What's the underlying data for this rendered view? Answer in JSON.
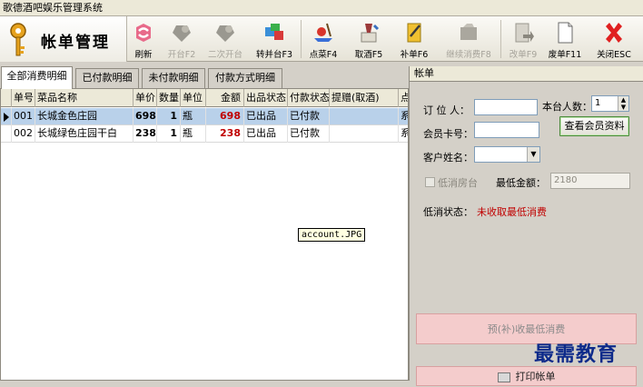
{
  "window": {
    "title": "歌德酒吧娱乐管理系统"
  },
  "header": {
    "logo_text": "帐单管理"
  },
  "toolbar": [
    {
      "key": "refresh",
      "label": "刷新",
      "icon": "refresh-icon",
      "enabled": true
    },
    {
      "key": "open_table",
      "label": "开台F2",
      "icon": "open-table-icon",
      "enabled": false
    },
    {
      "key": "second_open",
      "label": "二次开台",
      "icon": "second-open-icon",
      "enabled": false
    },
    {
      "key": "transfer",
      "label": "转并台F3",
      "icon": "transfer-table-icon",
      "enabled": true
    },
    {
      "key": "order",
      "label": "点菜F4",
      "icon": "order-dishes-icon",
      "enabled": true
    },
    {
      "key": "wine",
      "label": "取酒F5",
      "icon": "take-wine-icon",
      "enabled": true
    },
    {
      "key": "supplement",
      "label": "补单F6",
      "icon": "supplement-order-icon",
      "enabled": true
    },
    {
      "key": "continue",
      "label": "继续消费F8",
      "icon": "continue-consume-icon",
      "enabled": false
    },
    {
      "key": "modify",
      "label": "改单F9",
      "icon": "modify-order-icon",
      "enabled": false
    },
    {
      "key": "void",
      "label": "废单F11",
      "icon": "void-order-icon",
      "enabled": true
    },
    {
      "key": "close",
      "label": "关闭ESC",
      "icon": "close-icon",
      "enabled": true
    }
  ],
  "tabs": [
    "全部消费明细",
    "已付款明细",
    "未付款明细",
    "付款方式明细"
  ],
  "table": {
    "columns": [
      "单号",
      "菜品名称",
      "单价",
      "数量",
      "单位",
      "金额",
      "出品状态",
      "付款状态",
      "提赠(取酒)",
      "点"
    ],
    "rows": [
      {
        "no": "001",
        "name": "长城金色庄园",
        "price": "698",
        "qty": "1",
        "unit": "瓶",
        "amount": "698",
        "produce": "已出品",
        "pay": "已付款",
        "gift": "",
        "extra": "系"
      },
      {
        "no": "002",
        "name": "长城绿色庄园干白",
        "price": "238",
        "qty": "1",
        "unit": "瓶",
        "amount": "238",
        "produce": "已出品",
        "pay": "已付款",
        "gift": "",
        "extra": "系"
      }
    ]
  },
  "tooltip": "account.JPG",
  "bill": {
    "title": "帐单",
    "booker_label": "订 位 人：",
    "booker_value": "",
    "table_count_label": "本台人数：",
    "table_count_value": "1",
    "member_card_label": "会员卡号：",
    "member_card_value": "",
    "view_member_button": "查看会员资料",
    "customer_label": "客户姓名：",
    "customer_value": "",
    "min_room_label": "低消房台",
    "min_amount_label": "最低金额：",
    "min_amount_value": "2180",
    "min_status_label": "低消状态：",
    "min_status_value": "未收取最低消费",
    "prepay_button": "预(补)收最低消费",
    "print_button": "打印帐单"
  },
  "watermark": "最需教育",
  "colors": {
    "selected_row": "#b9d1ea",
    "amount_red": "#c00000",
    "status_red": "#c00000",
    "pink_button": "#f4cccc"
  }
}
